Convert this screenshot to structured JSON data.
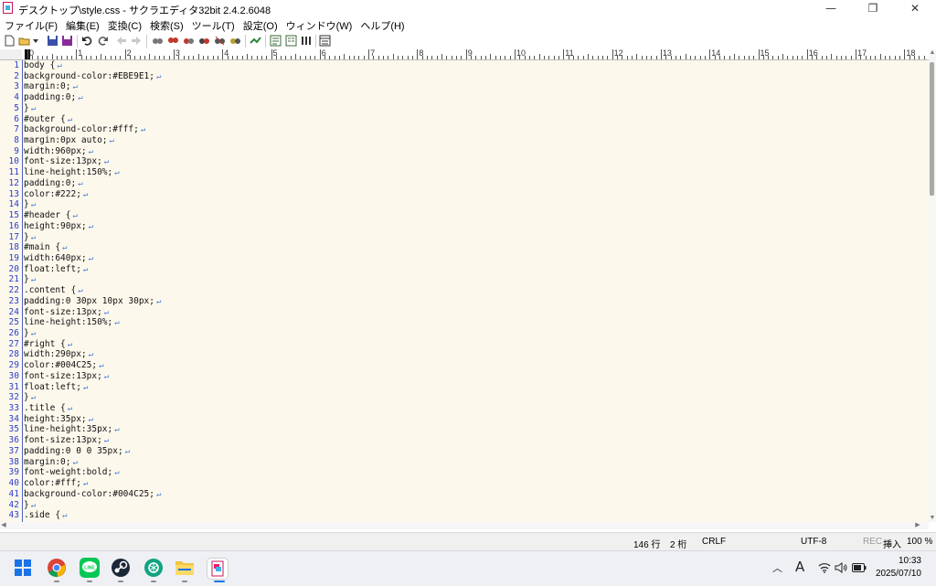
{
  "window": {
    "title": "デスクトップ\\style.css - サクラエディタ32bit 2.4.2.6048",
    "controls": [
      "—",
      "❐",
      "✕"
    ]
  },
  "menu": [
    "ファイル(F)",
    "編集(E)",
    "変換(C)",
    "検索(S)",
    "ツール(T)",
    "設定(O)",
    "ウィンドウ(W)",
    "ヘルプ(H)"
  ],
  "ruler": [
    "0",
    "1",
    "2",
    "3",
    "4",
    "5",
    "6",
    "7",
    "8",
    "9",
    "10",
    "11",
    "12",
    "13",
    "14",
    "15",
    "16",
    "17",
    "18"
  ],
  "lines": [
    "body {",
    "background-color:#EBE9E1;",
    "margin:0;",
    "padding:0;",
    "}",
    "#outer {",
    "background-color:#fff;",
    "margin:0px auto;",
    "width:960px;",
    "font-size:13px;",
    "line-height:150%;",
    "padding:0;",
    "color:#222;",
    "}",
    "#header {",
    "height:90px;",
    "}",
    "#main {",
    "width:640px;",
    "float:left;",
    "}",
    ".content {",
    "padding:0 30px 10px 30px;",
    "font-size:13px;",
    "line-height:150%;",
    "}",
    "#right {",
    "width:290px;",
    "color:#004C25;",
    "font-size:13px;",
    "float:left;",
    "}",
    ".title {",
    "height:35px;",
    "line-height:35px;",
    "font-size:13px;",
    "padding:0 0 0 35px;",
    "margin:0;",
    "font-weight:bold;",
    "color:#fff;",
    "background-color:#004C25;",
    "}",
    ".side {"
  ],
  "status": {
    "line": "146 行",
    "col": "2 桁",
    "eol": "CRLF",
    "encoding": "UTF-8",
    "rec": "REC",
    "mode": "挿入",
    "zoom": "100 %"
  },
  "taskbar": {
    "time": "10:33",
    "date": "2025/07/10",
    "ime": "A",
    "apps": [
      "windows-start",
      "chrome",
      "line",
      "steam",
      "chatgpt",
      "file-explorer",
      "sakura-editor"
    ]
  },
  "colors": {
    "editor_bg": "#fdf8ec",
    "line_number": "#2a3dcc",
    "eol_mark": "#4a7fd6"
  }
}
